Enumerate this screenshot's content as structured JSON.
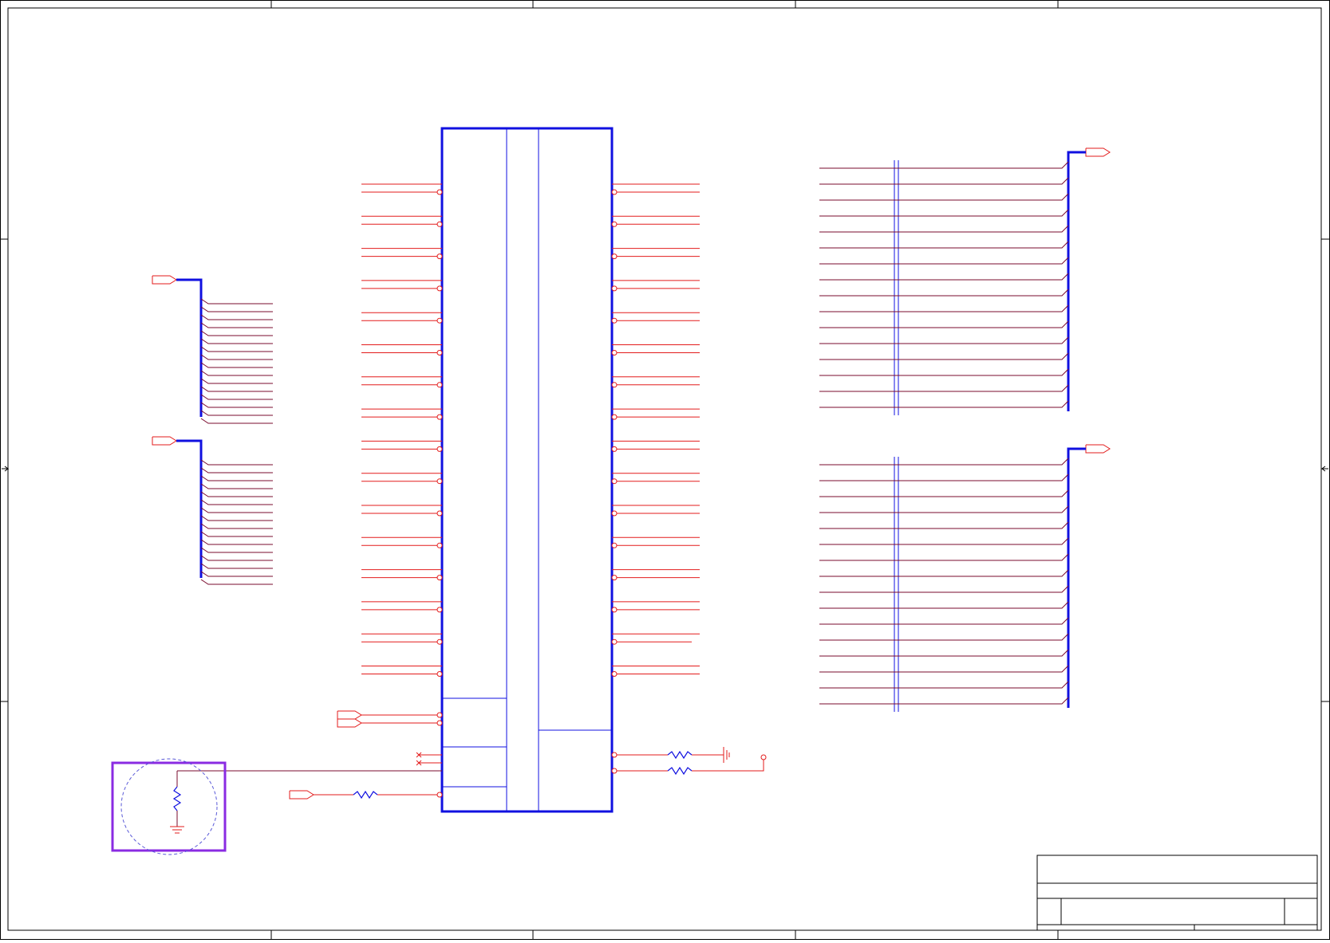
{
  "sheet": {
    "title_block": {
      "rows": [
        "",
        "",
        ""
      ]
    },
    "zone_marks": {
      "left_arrow": "left-arrow",
      "right_arrow": "right-arrow"
    }
  },
  "colors": {
    "frame": "#000000",
    "wire": "#7a0b2e",
    "pin": "#e31b1b",
    "bus": "#1010e0",
    "component_outline": "#1010e0",
    "selection": "#8a2be2",
    "selection_halo": "#5a5ad8"
  },
  "connector": {
    "left_pin_count": 16,
    "right_pin_count": 16,
    "bottom_left_ports": 2,
    "bottom_right_nets": 2
  },
  "left_buses": {
    "bus_count": 2,
    "lines_per_bus": 16
  },
  "right_buses": {
    "bus_count": 2,
    "lines_per_bus": 16
  },
  "icons": {
    "port": "port-flag-icon",
    "resistor": "resistor-icon",
    "ground": "ground-icon",
    "test_point": "test-point-icon",
    "no_connect": "no-connect-icon"
  }
}
